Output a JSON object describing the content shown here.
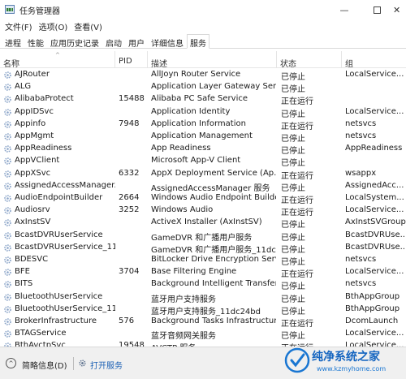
{
  "window": {
    "title": "任务管理器",
    "minimize_glyph": "—",
    "close_glyph": "✕"
  },
  "menu": [
    "文件(F)",
    "选项(O)",
    "查看(V)"
  ],
  "tabs": [
    "进程",
    "性能",
    "应用历史记录",
    "启动",
    "用户",
    "详细信息",
    "服务"
  ],
  "active_tab": "服务",
  "columns": {
    "name": "名称",
    "pid": "PID",
    "desc": "描述",
    "status": "状态",
    "group": "组",
    "sort_indicator": "^"
  },
  "services": [
    {
      "name": "AJRouter",
      "pid": "",
      "desc": "AllJoyn Router Service",
      "status": "已停止",
      "group": "LocalService..."
    },
    {
      "name": "ALG",
      "pid": "",
      "desc": "Application Layer Gateway Serv...",
      "status": "已停止",
      "group": ""
    },
    {
      "name": "AlibabaProtect",
      "pid": "15488",
      "desc": "Alibaba PC Safe Service",
      "status": "正在运行",
      "group": ""
    },
    {
      "name": "AppIDSvc",
      "pid": "",
      "desc": "Application Identity",
      "status": "已停止",
      "group": "LocalService..."
    },
    {
      "name": "Appinfo",
      "pid": "7948",
      "desc": "Application Information",
      "status": "正在运行",
      "group": "netsvcs"
    },
    {
      "name": "AppMgmt",
      "pid": "",
      "desc": "Application Management",
      "status": "已停止",
      "group": "netsvcs"
    },
    {
      "name": "AppReadiness",
      "pid": "",
      "desc": "App Readiness",
      "status": "已停止",
      "group": "AppReadiness"
    },
    {
      "name": "AppVClient",
      "pid": "",
      "desc": "Microsoft App-V Client",
      "status": "已停止",
      "group": ""
    },
    {
      "name": "AppXSvc",
      "pid": "6332",
      "desc": "AppX Deployment Service (Ap...",
      "status": "正在运行",
      "group": "wsappx"
    },
    {
      "name": "AssignedAccessManager...",
      "pid": "",
      "desc": "AssignedAccessManager 服务",
      "status": "已停止",
      "group": "AssignedAcc..."
    },
    {
      "name": "AudioEndpointBuilder",
      "pid": "2664",
      "desc": "Windows Audio Endpoint Builder",
      "status": "正在运行",
      "group": "LocalSystem..."
    },
    {
      "name": "Audiosrv",
      "pid": "3252",
      "desc": "Windows Audio",
      "status": "正在运行",
      "group": "LocalService..."
    },
    {
      "name": "AxInstSV",
      "pid": "",
      "desc": "ActiveX Installer (AxInstSV)",
      "status": "已停止",
      "group": "AxInstSVGroup"
    },
    {
      "name": "BcastDVRUserService",
      "pid": "",
      "desc": "GameDVR 和广播用户服务",
      "status": "已停止",
      "group": "BcastDVRUse..."
    },
    {
      "name": "BcastDVRUserService_11...",
      "pid": "",
      "desc": "GameDVR 和广播用户服务_11dc...",
      "status": "已停止",
      "group": "BcastDVRUse..."
    },
    {
      "name": "BDESVC",
      "pid": "",
      "desc": "BitLocker Drive Encryption Serv...",
      "status": "已停止",
      "group": "netsvcs"
    },
    {
      "name": "BFE",
      "pid": "3704",
      "desc": "Base Filtering Engine",
      "status": "正在运行",
      "group": "LocalService..."
    },
    {
      "name": "BITS",
      "pid": "",
      "desc": "Background Intelligent Transfer...",
      "status": "已停止",
      "group": "netsvcs"
    },
    {
      "name": "BluetoothUserService",
      "pid": "",
      "desc": "蓝牙用户支持服务",
      "status": "已停止",
      "group": "BthAppGroup"
    },
    {
      "name": "BluetoothUserService_11...",
      "pid": "",
      "desc": "蓝牙用户支持服务_11dc24bd",
      "status": "已停止",
      "group": "BthAppGroup"
    },
    {
      "name": "BrokerInfrastructure",
      "pid": "576",
      "desc": "Background Tasks Infrastructur...",
      "status": "正在运行",
      "group": "DcomLaunch"
    },
    {
      "name": "BTAGService",
      "pid": "",
      "desc": "蓝牙音频网关服务",
      "status": "已停止",
      "group": "LocalService..."
    },
    {
      "name": "BthAvctpSvc",
      "pid": "19548",
      "desc": "AVCTP 服务",
      "status": "正在运行",
      "group": "LocalService..."
    }
  ],
  "statusbar": {
    "collapse_glyph": "^",
    "summary": "简略信息(D)",
    "open_services": "打开服务"
  },
  "watermark": {
    "title": "纯净系统之家",
    "url": "www.kzmyhome.com"
  },
  "colors": {
    "link": "#1a5fb4",
    "watermark": "#1565c0",
    "service_icon": "#8aa4c8"
  }
}
